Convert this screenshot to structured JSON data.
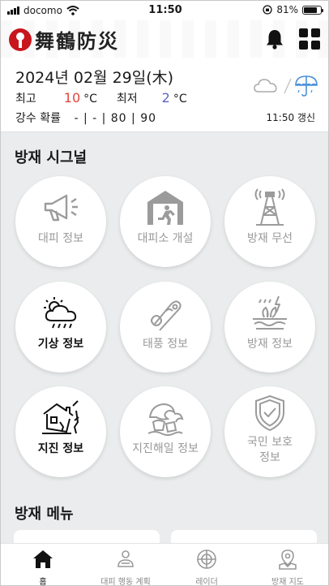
{
  "status_bar": {
    "carrier": "docomo",
    "time": "11:50",
    "battery_percent": "81%",
    "battery_level": 0.81
  },
  "header": {
    "logo_text": "舞鶴防災",
    "icons": [
      "bell-icon",
      "grid-menu-icon"
    ]
  },
  "weather": {
    "date": "2024년 02월 29일(木)",
    "high_label": "최고",
    "high_value": "10",
    "low_label": "최저",
    "low_value": "2",
    "unit": "°C",
    "precip_label": "강수 확률",
    "precip_values": "- | - | 80 | 90",
    "updated": "11:50 갱신",
    "icons": [
      "cloud-icon",
      "umbrella-icon"
    ]
  },
  "signals": {
    "title": "방재 시그널",
    "items": [
      {
        "label": "대피 정보",
        "icon": "megaphone-icon",
        "active": false
      },
      {
        "label": "대피소 개설",
        "icon": "shelter-icon",
        "active": false
      },
      {
        "label": "방재 무선",
        "icon": "radio-tower-icon",
        "active": false
      },
      {
        "label": "기상 정보",
        "icon": "weather-storm-icon",
        "active": true
      },
      {
        "label": "태풍 정보",
        "icon": "typhoon-icon",
        "active": false
      },
      {
        "label": "방재 정보",
        "icon": "disaster-flood-icon",
        "active": false
      },
      {
        "label": "지진 정보",
        "icon": "earthquake-house-icon",
        "active": true
      },
      {
        "label": "지진해일 정보",
        "icon": "tsunami-icon",
        "active": false
      },
      {
        "label": "국민 보호\n정보",
        "line1": "국민 보호",
        "line2": "정보",
        "icon": "shield-check-icon",
        "active": false
      }
    ]
  },
  "menu": {
    "title": "방재 메뉴"
  },
  "bottom_nav": {
    "items": [
      {
        "label": "홈",
        "icon": "home-icon",
        "active": true
      },
      {
        "label": "대피 행동 계획",
        "icon": "evacuation-plan-icon",
        "active": false
      },
      {
        "label": "레이더",
        "icon": "radar-icon",
        "active": false
      },
      {
        "label": "방재 지도",
        "icon": "map-pin-icon",
        "active": false
      }
    ]
  },
  "colors": {
    "accent_red": "#c8161d",
    "high_temp": "#e0453c",
    "low_temp": "#5b63c9",
    "background": "#eaeced",
    "inactive": "#9a9a9a"
  }
}
